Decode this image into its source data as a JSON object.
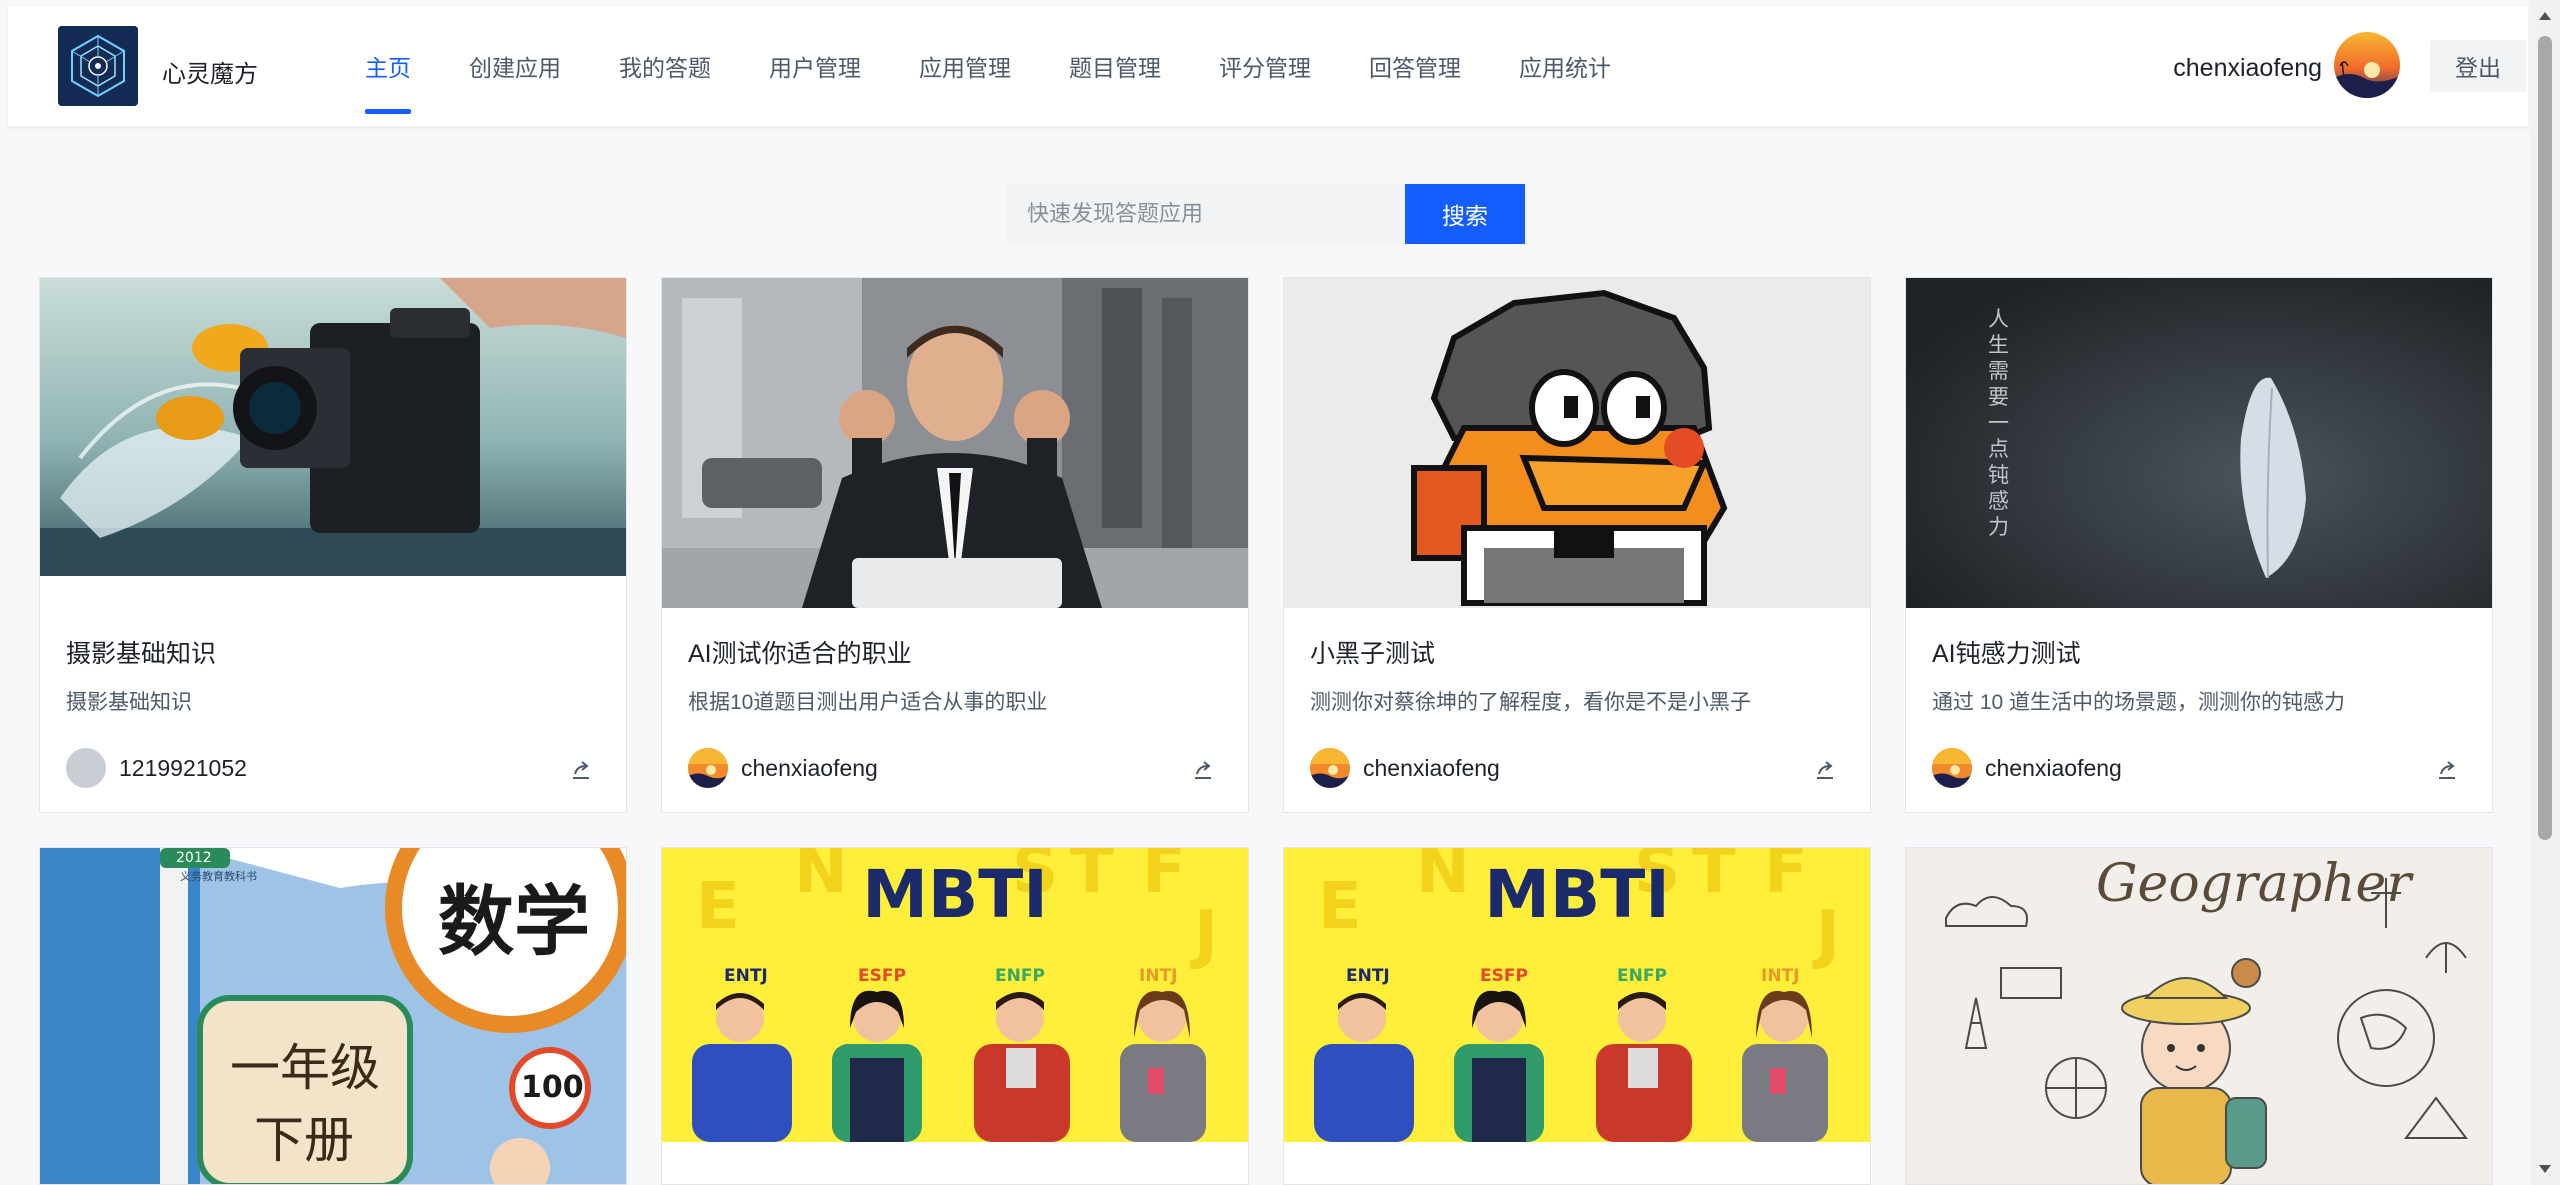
{
  "header": {
    "brand": "心灵魔方",
    "nav": [
      "主页",
      "创建应用",
      "我的答题",
      "用户管理",
      "应用管理",
      "题目管理",
      "评分管理",
      "回答管理",
      "应用统计"
    ],
    "active_index": 0,
    "username": "chenxiaofeng",
    "logout_label": "登出"
  },
  "search": {
    "placeholder": "快速发现答题应用",
    "button_label": "搜索"
  },
  "cards": [
    {
      "title": "摄影基础知识",
      "desc": "摄影基础知识",
      "author": "1219921052"
    },
    {
      "title": "AI测试你适合的职业",
      "desc": "根据10道题目测出用户适合从事的职业",
      "author": "chenxiaofeng"
    },
    {
      "title": "小黑子测试",
      "desc": "测测你对蔡徐坤的了解程度，看你是不是小黑子",
      "author": "chenxiaofeng"
    },
    {
      "title": "AI钝感力测试",
      "desc": "通过 10 道生活中的场景题，测测你的钝感力",
      "author": "chenxiaofeng"
    }
  ],
  "covers": {
    "math_book_title": "数学",
    "math_book_grade": "一年级",
    "math_book_volume": "下册",
    "math_book_badge": "100",
    "math_book_year": "2012",
    "math_book_publisher": "义务教育教科书",
    "mbti_title": "MBTI",
    "mbti_types": [
      "ENTJ",
      "ESFP",
      "ENFP",
      "INTJ"
    ],
    "mbti_bg_letters": [
      "E",
      "N",
      "S",
      "T",
      "F",
      "J"
    ],
    "geo_title": "Geographer",
    "feather_text": "人生需要一点钝感力"
  },
  "colors": {
    "primary": "#165dff",
    "mbti_yellow": "#ffef3a"
  }
}
